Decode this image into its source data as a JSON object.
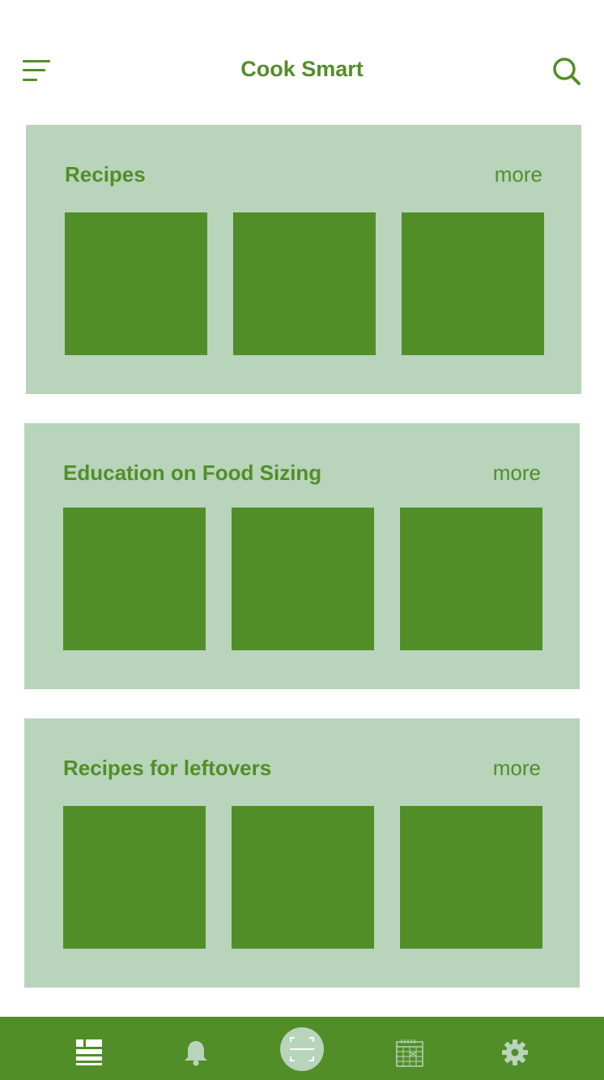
{
  "app": {
    "title": "Cook Smart"
  },
  "colors": {
    "accent": "#528e28",
    "card_background": "#b8d4bb",
    "nav_icon_inactive": "#b8d4bb"
  },
  "header": {
    "menu_icon": "menu-icon",
    "search_icon": "search-icon"
  },
  "sections": [
    {
      "title": "Recipes",
      "more_label": "more",
      "tile_count": 3
    },
    {
      "title": "Education on Food Sizing",
      "more_label": "more",
      "tile_count": 3
    },
    {
      "title": "Recipes for leftovers",
      "more_label": "more",
      "tile_count": 3
    }
  ],
  "bottom_nav": {
    "items": [
      {
        "icon": "feed-icon",
        "active": true
      },
      {
        "icon": "bell-icon",
        "active": false
      },
      {
        "icon": "scan-icon",
        "active": false
      },
      {
        "icon": "calendar-icon",
        "active": false
      },
      {
        "icon": "gear-icon",
        "active": false
      }
    ]
  }
}
